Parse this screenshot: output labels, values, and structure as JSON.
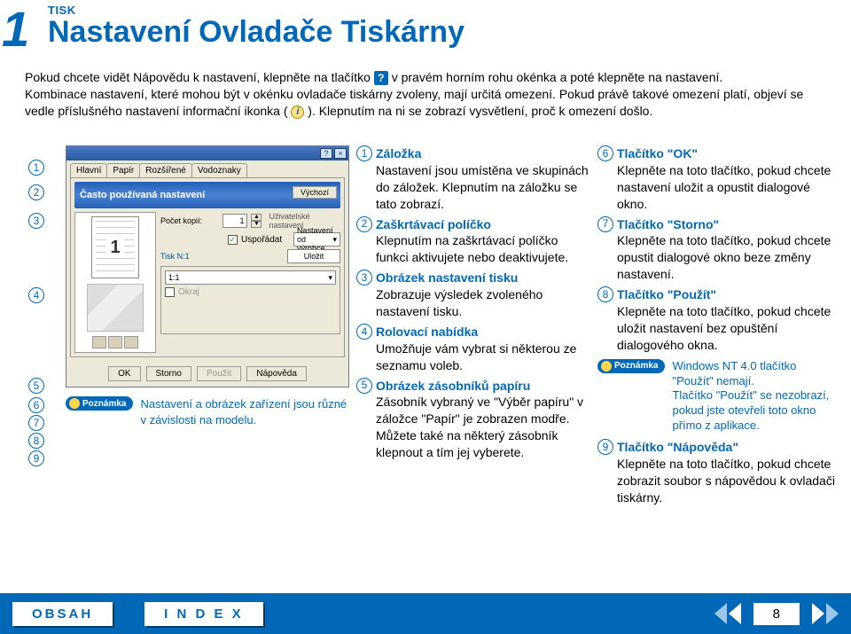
{
  "page_number_top": "1",
  "header": {
    "small": "TISK",
    "title": "Nastavení Ovladače Tiskárny"
  },
  "intro": {
    "p1a": "Pokud chcete vidět Nápovědu k nastavení, klepněte na tlačítko ",
    "p1b": " v pravém horním rohu okénka a poté klepněte na nastavení.",
    "p2a": "Kombinace nastavení, které mohou být v okénku ovladače tiskárny zvoleny, mají určitá omezení. Pokud právě takové omezení platí, objeví se vedle příslušného nastavení informační ikonka ( ",
    "p2b": " ). Klepnutím na ni se zobrazí vysvětlení, proč k omezení došlo."
  },
  "markers": [
    "1",
    "2",
    "3",
    "4",
    "5",
    "6",
    "7",
    "8",
    "9"
  ],
  "screenshot": {
    "tabs": [
      "Hlavní",
      "Papír",
      "Rozšířené",
      "Vodoznaky"
    ],
    "banner": "Často používaná nastavení",
    "default_btn": "Výchozí",
    "thumb_num": "1",
    "rows": {
      "copies_label": "Počet kopií:",
      "copies_value": "1",
      "user_settings": "Uživatelské nastavení",
      "collate": "Uspořádat",
      "preset_label": "",
      "preset_value": "Nastavení od výrobce",
      "save": "Uložit",
      "tisk_label": "Tisk N:1",
      "tisk_value": "1:1",
      "border": "Okraj"
    },
    "buttons": {
      "ok": "OK",
      "cancel": "Storno",
      "apply": "Použít",
      "help": "Nápověda"
    },
    "titlebar": {
      "help": "?",
      "close": "×"
    }
  },
  "caption_note_label": "Poznámka",
  "caption_text": "Nastavení a obrázek zařízení jsou různé v závislosti na modelu.",
  "list_mid": [
    {
      "n": "1",
      "title": "Záložka",
      "body": "Nastavení jsou umístěna ve skupinách do záložek. Klepnutím na záložku se tato zobrazí."
    },
    {
      "n": "2",
      "title": "Zaškrtávací políčko",
      "body": "Klepnutím na zaškrtávací políčko funkci aktivujete nebo deaktivujete."
    },
    {
      "n": "3",
      "title": "Obrázek nastavení tisku",
      "body": "Zobrazuje výsledek zvoleného nastavení tisku."
    },
    {
      "n": "4",
      "title": "Rolovací nabídka",
      "body": "Umožňuje vám vybrat si některou ze seznamu voleb."
    },
    {
      "n": "5",
      "title": "Obrázek zásobníků papíru",
      "body": "Zásobník vybraný ve \"Výběr papíru\" v záložce \"Papír\" je zobrazen modře. Můžete také na některý zásobník klepnout a tím jej vyberete."
    }
  ],
  "list_right": [
    {
      "n": "6",
      "title": "Tlačítko \"OK\"",
      "body": "Klepněte na toto tlačítko, pokud chcete nastavení uložit a opustit dialogové okno."
    },
    {
      "n": "7",
      "title": "Tlačítko \"Storno\"",
      "body": "Klepněte na toto tlačítko, pokud chcete opustit dialogové okno beze změny nastavení."
    },
    {
      "n": "8",
      "title": "Tlačítko \"Použít\"",
      "body": "Klepněte na toto tlačítko, pokud chcete uložit nastavení bez opuštění dialogového okna."
    }
  ],
  "right_note": "Windows NT 4.0 tlačítko \"Použít\" nemají.\nTlačítko \"Použít\" se nezobrazí, pokud jste otevřeli toto okno přímo z aplikace.",
  "list_right_after": [
    {
      "n": "9",
      "title": "Tlačítko \"Nápověda\"",
      "body": "Klepněte na toto tlačítko, pokud chcete zobrazit soubor s nápovědou k ovladači tiskárny."
    }
  ],
  "footer": {
    "obsah": "OBSAH",
    "index": "I N D E X",
    "page": "8"
  }
}
